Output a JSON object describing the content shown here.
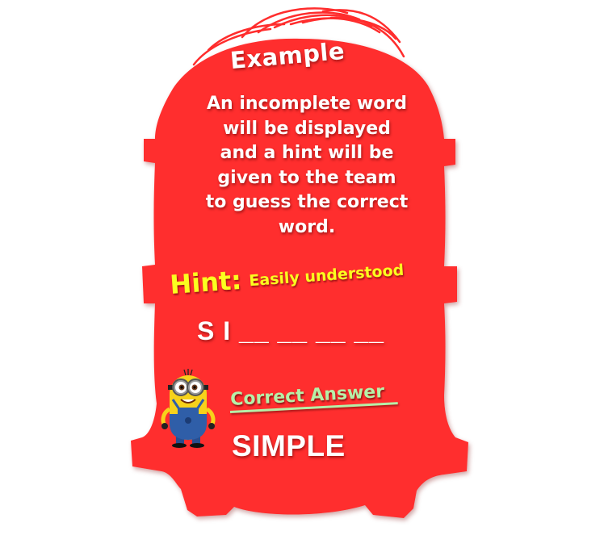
{
  "card": {
    "title": "Example",
    "description": "An incomplete word\nwill be displayed\nand a hint will be\ngiven to the team\nto guess the correct\nword.",
    "hint_label": "Hint:",
    "hint_text": "Easily understood",
    "puzzle_word": "S I  __ __ __ __",
    "correct_answer_label": "Correct Answer",
    "answer": "SIMPLE"
  },
  "colors": {
    "card_red": "#ff2d2d",
    "text_white": "#ffffff",
    "hint_yellow": "#fbff1f",
    "answer_label_green": "#b6f0a8"
  },
  "icons": {
    "mascot": "minion-icon"
  }
}
